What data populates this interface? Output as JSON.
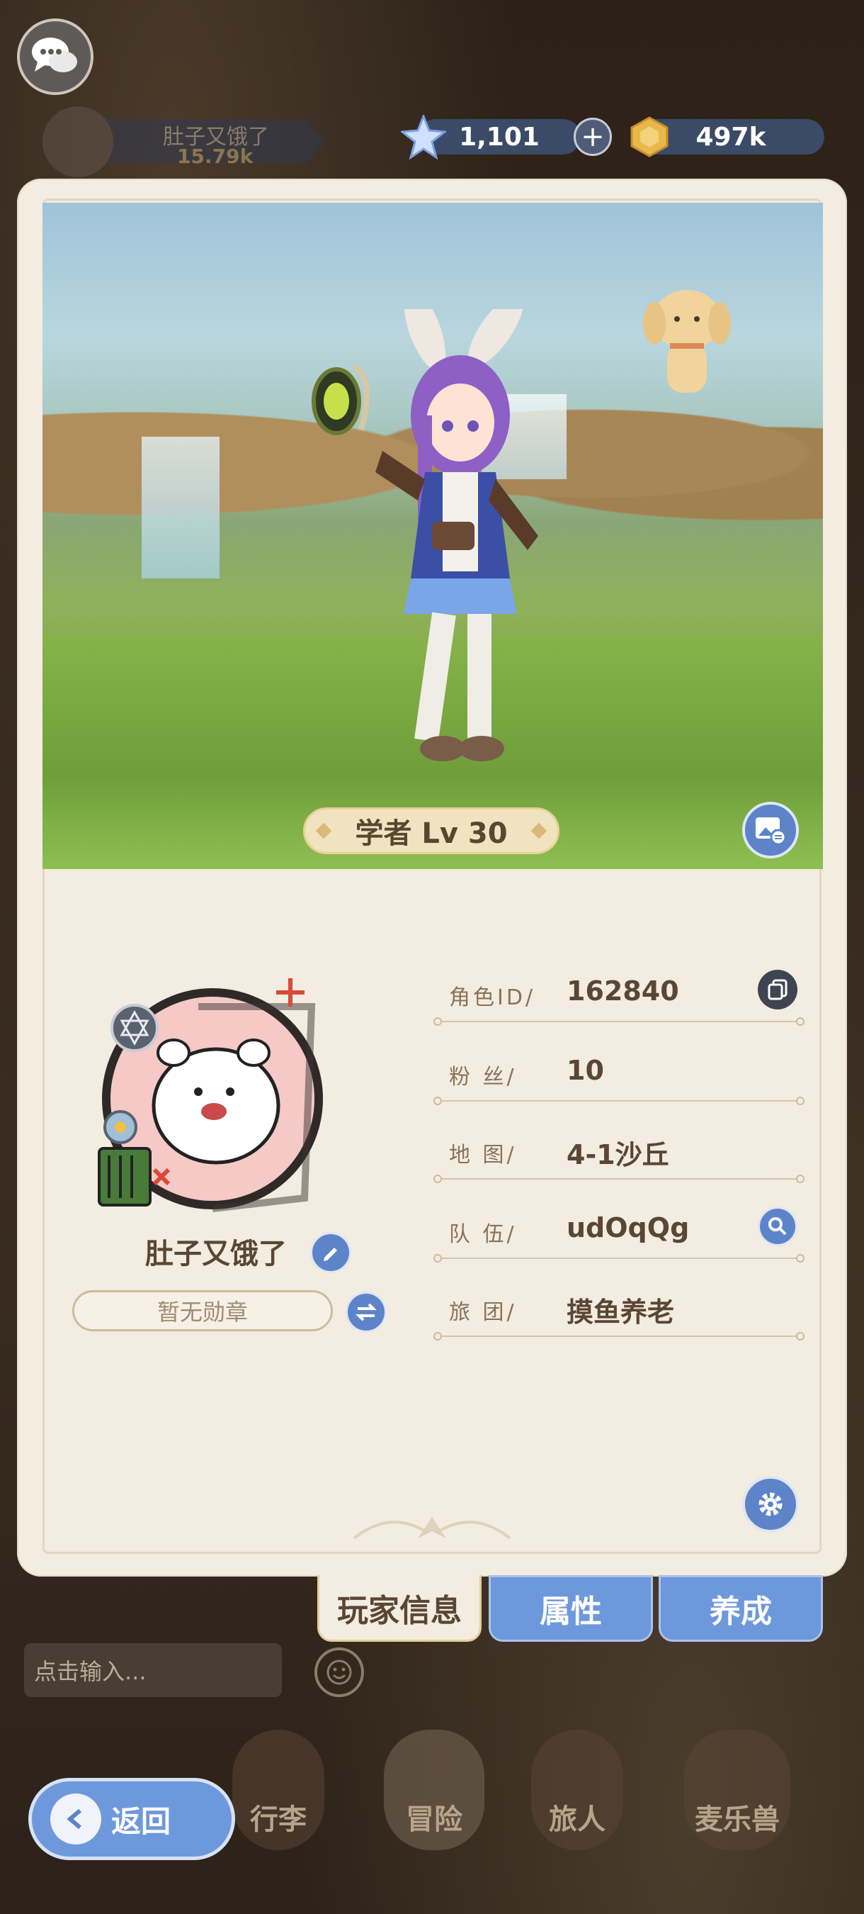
{
  "topbar": {
    "bg_player_name": "肚子又饿了",
    "bg_player_power": "15.79k",
    "star_currency": "1,101",
    "coin_currency": "497k"
  },
  "scene": {
    "class_level": "学者 Lv 30"
  },
  "profile": {
    "player_name": "肚子又饿了",
    "medal": "暂无勋章",
    "rows": [
      {
        "label": "角色ID/",
        "value": "162840"
      },
      {
        "label": "粉  丝/",
        "value": "10"
      },
      {
        "label": "地  图/",
        "value": "4-1沙丘"
      },
      {
        "label": "队  伍/",
        "value": "udOqQg"
      },
      {
        "label": "旅  团/",
        "value": "摸鱼养老"
      }
    ]
  },
  "tabs": {
    "player_info": "玩家信息",
    "attributes": "属性",
    "develop": "养成"
  },
  "bottom": {
    "chat_placeholder": "点击输入...",
    "nav": [
      "行李",
      "冒险",
      "旅人",
      "麦乐兽"
    ],
    "back": "返回"
  },
  "colors": {
    "accent_blue": "#6e98dc",
    "card_bg": "#f3ece0",
    "text_brown": "#5a4634"
  }
}
